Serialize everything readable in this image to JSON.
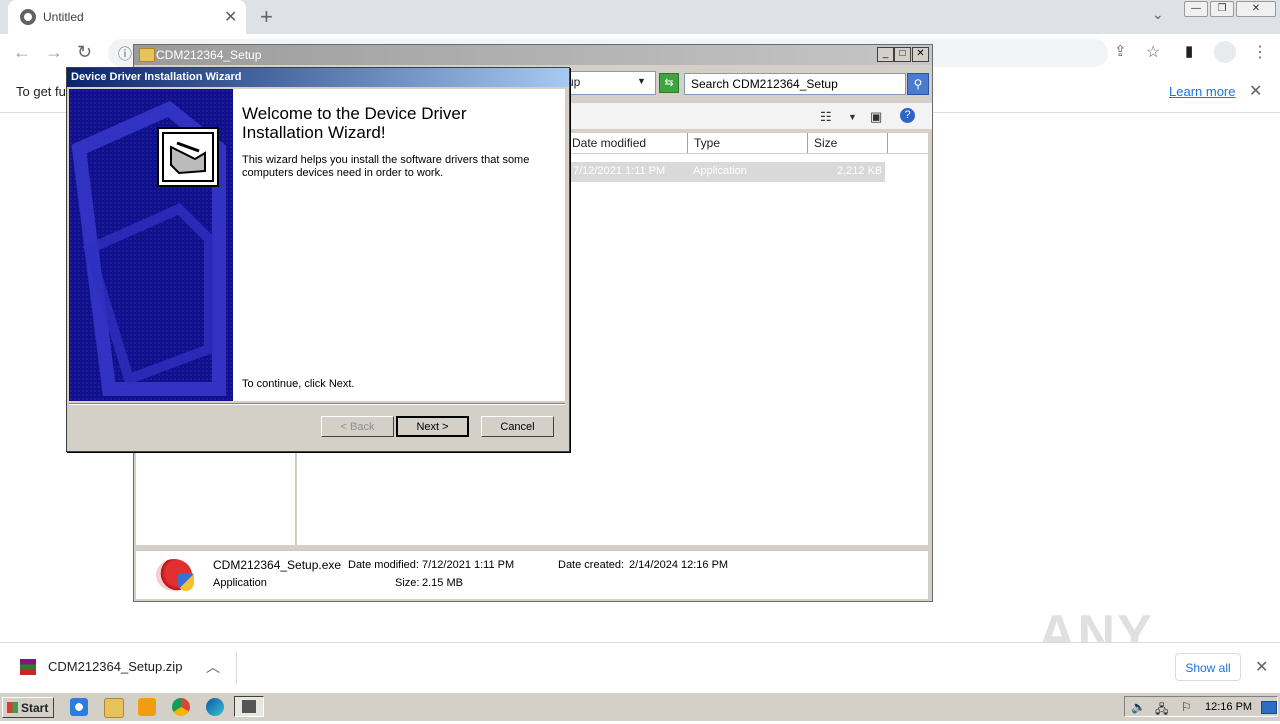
{
  "browser": {
    "tab_title": "Untitled",
    "infobar_text": "To get fu",
    "infobar_link": "Learn more"
  },
  "explorer": {
    "title": "CDM212364_Setup",
    "address_value": "up",
    "search_placeholder": "Search CDM212364_Setup",
    "columns": [
      "Date modified",
      "Type",
      "Size"
    ],
    "file_row": {
      "date": "7/12/2021 1:11 PM",
      "type": "Application",
      "size": "2,212 KB"
    },
    "details": {
      "name": "CDM212364_Setup.exe",
      "kind": "Application",
      "date_modified_label": "Date modified:",
      "date_modified": "7/12/2021 1:11 PM",
      "size_label": "Size:",
      "size": "2.15 MB",
      "date_created_label": "Date created:",
      "date_created": "2/14/2024 12:16 PM"
    }
  },
  "wizard": {
    "title": "Device Driver Installation Wizard",
    "heading": "Welcome to the Device Driver Installation Wizard!",
    "description": "This wizard helps you install the software drivers that some computers devices need in order to work.",
    "continue_text": "To continue, click Next.",
    "back_label": "< Back",
    "next_label": "Next >",
    "cancel_label": "Cancel"
  },
  "downloads": {
    "file_name": "CDM212364_Setup.zip",
    "show_all": "Show all"
  },
  "taskbar": {
    "start_label": "Start",
    "clock": "12:16 PM"
  },
  "watermark": "ANY RUN",
  "colors": {
    "wizard_title": "#0a246a",
    "wizard_left_panel": "#10108c",
    "link": "#1a73e8",
    "taskbar": "#d4d0c8"
  }
}
